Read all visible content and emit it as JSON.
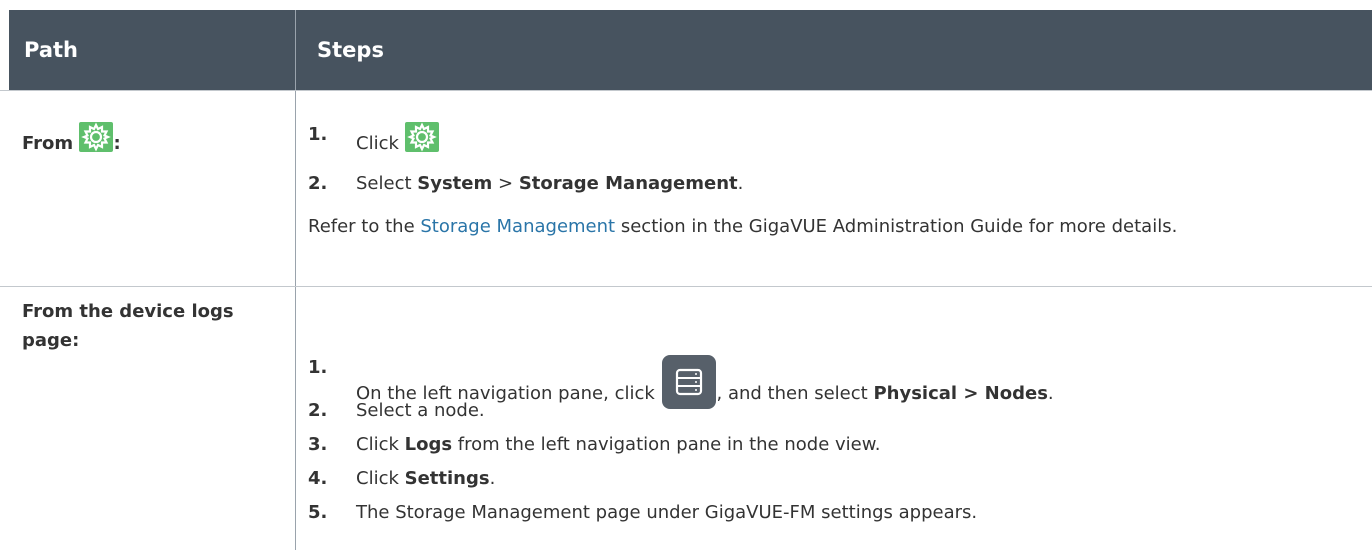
{
  "header": {
    "path": "Path",
    "steps": "Steps"
  },
  "rows": [
    {
      "path_from": "From",
      "path_colon": ":",
      "gear_icon": "gear-icon",
      "steps": [
        {
          "num": "1.",
          "text": "Click"
        },
        {
          "num": "2.",
          "select": "Select",
          "system": "System",
          "gt": ">",
          "storage": "Storage Management",
          "dot": "."
        }
      ],
      "note_pre": "Refer to the",
      "note_link": "Storage Management",
      "note_post": "section in the GigaVUE Administration Guide for more details."
    },
    {
      "path": "From the device logs page:",
      "nav_icon": "server-list-icon",
      "steps": [
        {
          "num": "1.",
          "pre": "On the left navigation pane, click",
          "mid": ", and then select",
          "bold": "Physical > Nodes",
          "dot": "."
        },
        {
          "num": "2.",
          "text": "Select a node."
        },
        {
          "num": "3.",
          "pre": "Click",
          "bold": "Logs",
          "post": "from the left navigation pane in the node view."
        },
        {
          "num": "4.",
          "pre": "Click",
          "bold": "Settings",
          "dot": "."
        },
        {
          "num": "5.",
          "text": "The Storage Management page under GigaVUE-FM settings appears."
        }
      ]
    }
  ],
  "colors": {
    "header_bg": "#47535f",
    "gear_green": "#5fbf6c",
    "link": "#2a75a8",
    "nav_btn": "#57606a"
  }
}
